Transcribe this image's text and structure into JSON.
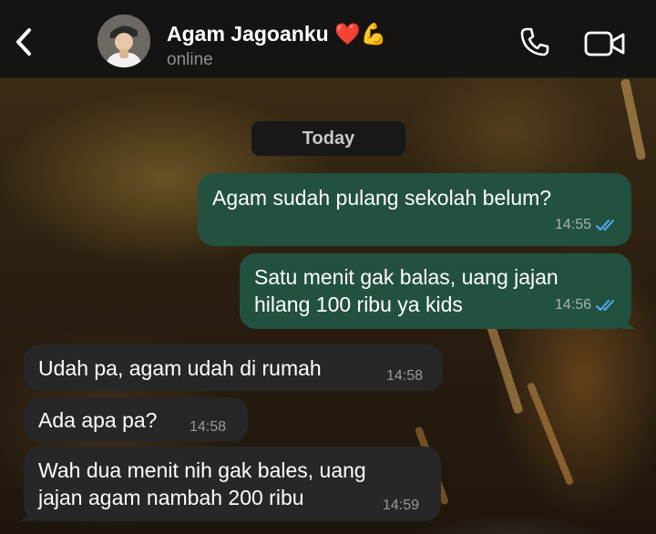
{
  "header": {
    "contact_name": "Agam Jagoanku ❤️💪",
    "status": "online"
  },
  "date_separator": "Today",
  "messages": [
    {
      "direction": "outgoing",
      "lines": [
        "Agam sudah pulang sekolah belum?"
      ],
      "time": "14:55",
      "read": true
    },
    {
      "direction": "outgoing",
      "lines": [
        "Satu menit gak balas, uang jajan",
        "hilang 100 ribu ya kids"
      ],
      "time": "14:56",
      "read": true
    },
    {
      "direction": "incoming",
      "lines": [
        "Udah pa, agam udah di rumah"
      ],
      "time": "14:58"
    },
    {
      "direction": "incoming",
      "lines": [
        "Ada apa pa?"
      ],
      "time": "14:58"
    },
    {
      "direction": "incoming",
      "lines": [
        "Wah dua menit nih gak bales, uang",
        "jajan agam nambah 200 ribu"
      ],
      "time": "14:59"
    }
  ],
  "icons": {
    "back": "chevron-left-icon",
    "call": "phone-icon",
    "video": "video-camera-icon",
    "read_receipt": "double-check-icon"
  },
  "colors": {
    "outgoing_bubble": "#235140",
    "incoming_bubble": "#272727",
    "read_tick": "#5aa8ff",
    "header_bg": "#161412"
  }
}
